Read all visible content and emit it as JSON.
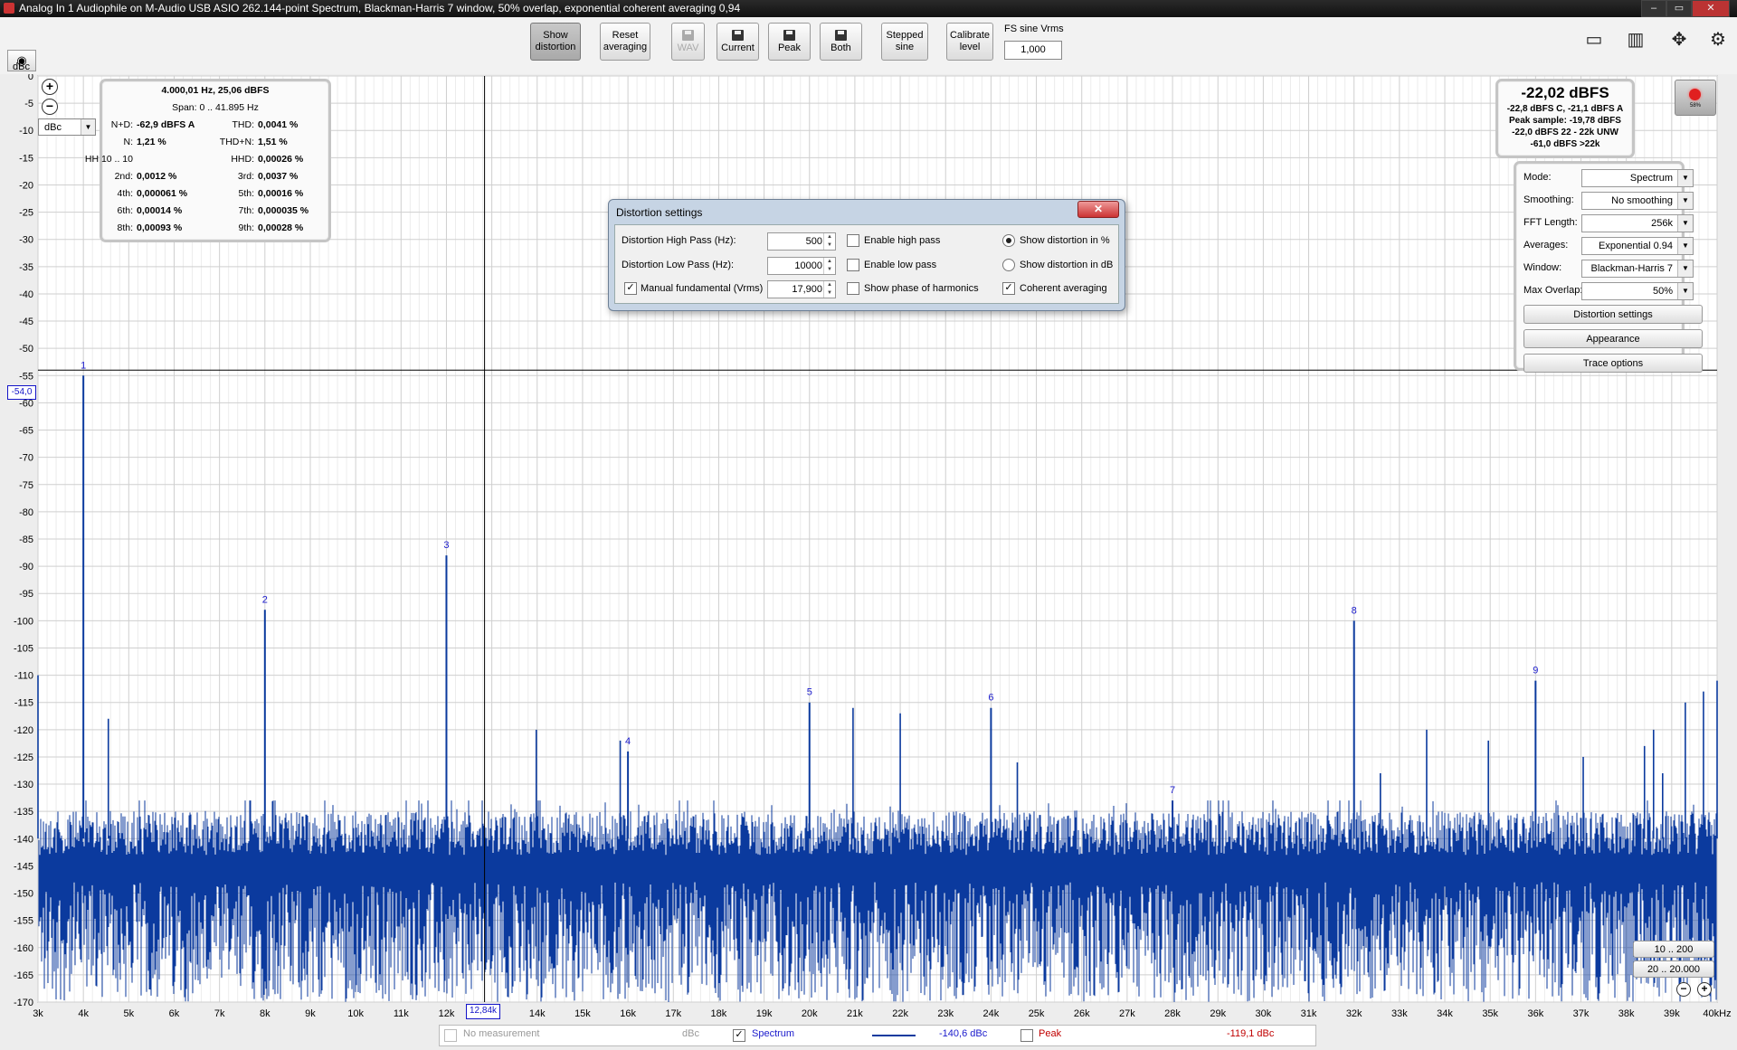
{
  "window": {
    "title": "Analog In 1 Audiophile on M-Audio USB ASIO 262.144-point Spectrum, Blackman-Harris 7 window, 50% overlap, exponential coherent averaging 0,94",
    "min_label": "–",
    "max_label": "▭",
    "close_label": "✕"
  },
  "toolbar": {
    "buttons": [
      {
        "line1": "Show",
        "line2": "distortion"
      },
      {
        "line1": "Reset",
        "line2": "averaging"
      },
      {
        "line1": "WAV",
        "line2": ""
      },
      {
        "line1": "Current",
        "line2": ""
      },
      {
        "line1": "Peak",
        "line2": ""
      },
      {
        "line1": "Both",
        "line2": ""
      },
      {
        "line1": "Stepped",
        "line2": "sine"
      },
      {
        "line1": "Calibrate",
        "line2": "level"
      }
    ],
    "fs_label": "FS sine Vrms",
    "fs_value": "1,000"
  },
  "stats": {
    "header": "4.000,01 Hz, 25,06 dBFS",
    "span": "Span: 0 .. 41.895 Hz",
    "rows": [
      {
        "l1": "N+D:",
        "v1": "-62,9 dBFS A",
        "l2": "THD:",
        "v2": "0,0041 %"
      },
      {
        "l1": "N:",
        "v1": "1,21 %",
        "l2": "THD+N:",
        "v2": "1,51 %"
      },
      {
        "l1": "HH 10 .. 10",
        "v1": "",
        "l2": "HHD:",
        "v2": "0,00026 %"
      },
      {
        "l1": "2nd:",
        "v1": "0,0012 %",
        "l2": "3rd:",
        "v2": "0,0037 %"
      },
      {
        "l1": "4th:",
        "v1": "0,000061 %",
        "l2": "5th:",
        "v2": "0,00016 %"
      },
      {
        "l1": "6th:",
        "v1": "0,00014 %",
        "l2": "7th:",
        "v2": "0,000035 %"
      },
      {
        "l1": "8th:",
        "v1": "0,00093 %",
        "l2": "9th:",
        "v2": "0,00028 %"
      }
    ]
  },
  "level": {
    "main": "-22,02 dBFS",
    "lines": [
      "-22,8 dBFS C, -21,1 dBFS A",
      "Peak sample: -19,78 dBFS",
      "-22,0 dBFS 22 - 22k UNW",
      "-61,0 dBFS >22k"
    ],
    "rec_pct": "58%"
  },
  "controls": {
    "rows": [
      {
        "label": "Mode:",
        "value": "Spectrum"
      },
      {
        "label": "Smoothing:",
        "value": "No  smoothing"
      },
      {
        "label": "FFT Length:",
        "value": "256k"
      },
      {
        "label": "Averages:",
        "value": "Exponential 0.94"
      },
      {
        "label": "Window:",
        "value": "Blackman-Harris 7"
      },
      {
        "label": "Max Overlap:",
        "value": "50%"
      }
    ],
    "buttons": [
      "Distortion settings",
      "Appearance",
      "Trace options"
    ]
  },
  "dialog": {
    "title": "Distortion settings",
    "high_pass_label": "Distortion High Pass (Hz):",
    "high_pass_value": "500",
    "low_pass_label": "Distortion Low Pass (Hz):",
    "low_pass_value": "10000",
    "manual_label": "Manual fundamental (Vrms)",
    "manual_value": "17,900",
    "enable_high_pass": "Enable high pass",
    "enable_low_pass": "Enable low pass",
    "show_phase": "Show phase of harmonics",
    "show_pct": "Show distortion in %",
    "show_db": "Show distortion in dB",
    "coherent": "Coherent averaging"
  },
  "plot": {
    "unit_label": "dBc",
    "unit_select": "dBc",
    "y_cursor": "-54,0",
    "x_cursor": "12,84k",
    "range_buttons": [
      "10 .. 200",
      "20 .. 20.000"
    ]
  },
  "legend": {
    "no_measurement": "No measurement",
    "no_measurement_unit": "dBc",
    "spectrum": "Spectrum",
    "spectrum_value": "-140,6 dBc",
    "peak": "Peak",
    "peak_value": "-119,1 dBc"
  },
  "colors": {
    "trace": "#0b3a9e",
    "grid": "#d6d6d6",
    "harmonic_label": "#1a1acc",
    "peak": "#c00000"
  },
  "chart_data": {
    "type": "line",
    "title": "",
    "xlabel": "",
    "ylabel": "dBc",
    "xlim": [
      3000,
      40000
    ],
    "ylim": [
      -170,
      0
    ],
    "x_ticks": [
      "3k",
      "4k",
      "5k",
      "6k",
      "7k",
      "8k",
      "9k",
      "10k",
      "11k",
      "12k",
      "13k",
      "14k",
      "15k",
      "16k",
      "17k",
      "18k",
      "19k",
      "20k",
      "21k",
      "22k",
      "23k",
      "24k",
      "25k",
      "26k",
      "27k",
      "28k",
      "29k",
      "30k",
      "31k",
      "32k",
      "33k",
      "34k",
      "35k",
      "36k",
      "37k",
      "38k",
      "39k",
      "40kHz"
    ],
    "y_ticks": [
      "0",
      "-5",
      "-10",
      "-15",
      "-20",
      "-25",
      "-30",
      "-35",
      "-40",
      "-45",
      "-50",
      "-55",
      "-60",
      "-65",
      "-70",
      "-75",
      "-80",
      "-85",
      "-90",
      "-95",
      "-100",
      "-105",
      "-110",
      "-115",
      "-120",
      "-125",
      "-130",
      "-135",
      "-140",
      "-145",
      "-150",
      "-155",
      "-160",
      "-165",
      "-170"
    ],
    "harmonics": [
      {
        "n": 1,
        "x": 4000,
        "y": -55
      },
      {
        "n": 2,
        "x": 8000,
        "y": -98
      },
      {
        "n": 3,
        "x": 12000,
        "y": -88
      },
      {
        "n": 4,
        "x": 16000,
        "y": -124
      },
      {
        "n": 5,
        "x": 20000,
        "y": -115
      },
      {
        "n": 6,
        "x": 24000,
        "y": -116
      },
      {
        "n": 7,
        "x": 28000,
        "y": -133
      },
      {
        "n": 8,
        "x": 32000,
        "y": -100
      },
      {
        "n": 9,
        "x": 36000,
        "y": -111
      }
    ],
    "spurs": [
      {
        "x": 3000,
        "y": -110
      },
      {
        "x": 4550,
        "y": -118
      },
      {
        "x": 13980,
        "y": -120
      },
      {
        "x": 15830,
        "y": -122
      },
      {
        "x": 20960,
        "y": -116
      },
      {
        "x": 22000,
        "y": -117
      },
      {
        "x": 24580,
        "y": -126
      },
      {
        "x": 32580,
        "y": -128
      },
      {
        "x": 33600,
        "y": -120
      },
      {
        "x": 34960,
        "y": -122
      },
      {
        "x": 37050,
        "y": -125
      },
      {
        "x": 38400,
        "y": -123
      },
      {
        "x": 38600,
        "y": -120
      },
      {
        "x": 38800,
        "y": -128
      },
      {
        "x": 39300,
        "y": -115
      },
      {
        "x": 39700,
        "y": -113
      },
      {
        "x": 40000,
        "y": -111
      }
    ],
    "noise_floor": {
      "low": -170,
      "high": -133,
      "typical": -145
    },
    "cursor": {
      "x": 12840,
      "y": -54
    }
  }
}
